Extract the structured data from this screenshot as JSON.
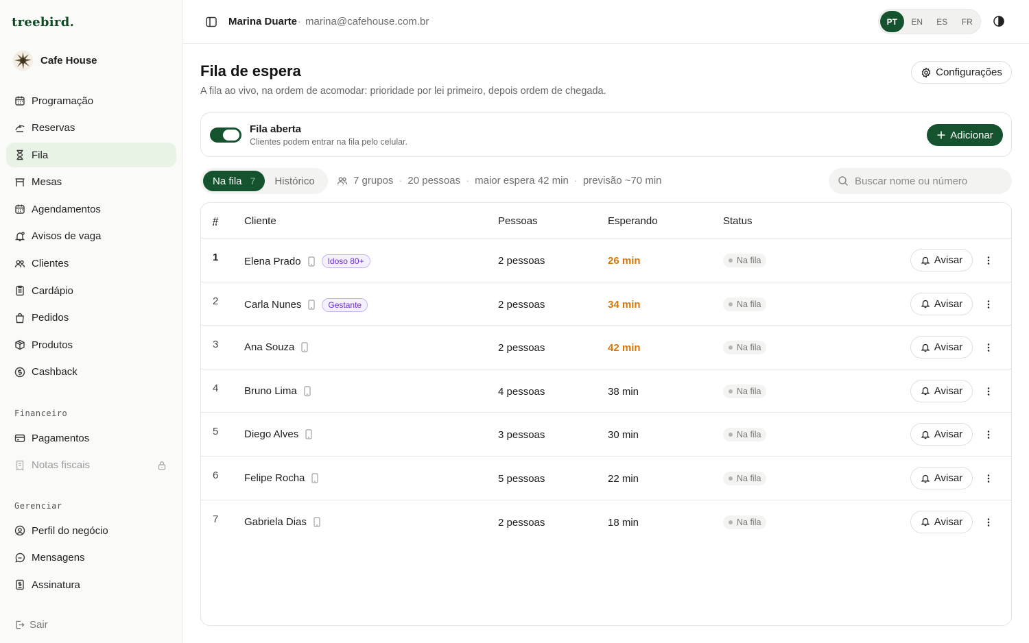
{
  "brand": {
    "logo_text": "treebird."
  },
  "business": {
    "name": "Cafe House",
    "avatar": "cafe-logo"
  },
  "sidebar": {
    "items": [
      {
        "label": "Programação",
        "icon": "calendar-icon"
      },
      {
        "label": "Reservas",
        "icon": "reservation-icon"
      },
      {
        "label": "Fila",
        "icon": "hourglass-icon",
        "active": true
      },
      {
        "label": "Mesas",
        "icon": "table-icon"
      },
      {
        "label": "Agendamentos",
        "icon": "calendar-icon"
      },
      {
        "label": "Avisos de vaga",
        "icon": "bell-icon"
      },
      {
        "label": "Clientes",
        "icon": "users-icon"
      },
      {
        "label": "Cardápio",
        "icon": "menu-book-icon"
      },
      {
        "label": "Pedidos",
        "icon": "bag-icon"
      },
      {
        "label": "Produtos",
        "icon": "box-icon"
      },
      {
        "label": "Cashback",
        "icon": "cashback-icon"
      }
    ],
    "financeiro_label": "Financeiro",
    "financeiro": [
      {
        "label": "Pagamentos",
        "icon": "card-icon"
      },
      {
        "label": "Notas fiscais",
        "icon": "receipt-icon",
        "locked": true
      }
    ],
    "gerenciar_label": "Gerenciar",
    "gerenciar": [
      {
        "label": "Perfil do negócio",
        "icon": "location-icon"
      },
      {
        "label": "Mensagens",
        "icon": "chat-icon"
      },
      {
        "label": "Assinatura",
        "icon": "invoice-icon"
      }
    ],
    "logout_label": "Sair"
  },
  "topbar": {
    "user_name": "Marina Duarte",
    "separator": "·",
    "user_email": "marina@cafehouse.com.br",
    "languages": [
      "PT",
      "EN",
      "ES",
      "FR"
    ],
    "active_language": "PT"
  },
  "page": {
    "title": "Fila de espera",
    "subtitle": "A fila ao vivo, na ordem de acomodar: prioridade por lei primeiro, depois ordem de chegada.",
    "settings_label": "Configurações"
  },
  "queue_status": {
    "title": "Fila aberta",
    "description": "Clientes podem entrar na fila pelo celular.",
    "open": true,
    "add_label": "Adicionar"
  },
  "tabs": [
    {
      "label": "Na fila",
      "count": "7",
      "active": true
    },
    {
      "label": "Histórico"
    }
  ],
  "stats": {
    "groups": "7 grupos",
    "people": "20 pessoas",
    "max_wait": "maior espera 42 min",
    "forecast": "previsão ~70 min"
  },
  "search": {
    "placeholder": "Buscar nome ou número",
    "value": ""
  },
  "table": {
    "headers": {
      "num": "#",
      "client": "Cliente",
      "people": "Pessoas",
      "waiting": "Esperando",
      "status": "Status"
    },
    "notify_label": "Avisar",
    "rows": [
      {
        "num": "1",
        "name": "Elena Prado",
        "tag": "Idoso 80+",
        "people": "2 pessoas",
        "waiting": "26 min",
        "late": true,
        "status": "Na fila"
      },
      {
        "num": "2",
        "name": "Carla Nunes",
        "tag": "Gestante",
        "people": "2 pessoas",
        "waiting": "34 min",
        "late": true,
        "status": "Na fila"
      },
      {
        "num": "3",
        "name": "Ana Souza",
        "tag": "",
        "people": "2 pessoas",
        "waiting": "42 min",
        "late": true,
        "status": "Na fila"
      },
      {
        "num": "4",
        "name": "Bruno Lima",
        "tag": "",
        "people": "4 pessoas",
        "waiting": "38 min",
        "late": false,
        "status": "Na fila"
      },
      {
        "num": "5",
        "name": "Diego Alves",
        "tag": "",
        "people": "3 pessoas",
        "waiting": "30 min",
        "late": false,
        "status": "Na fila"
      },
      {
        "num": "6",
        "name": "Felipe Rocha",
        "tag": "",
        "people": "5 pessoas",
        "waiting": "22 min",
        "late": false,
        "status": "Na fila"
      },
      {
        "num": "7",
        "name": "Gabriela Dias",
        "tag": "",
        "people": "2 pessoas",
        "waiting": "18 min",
        "late": false,
        "status": "Na fila"
      }
    ]
  },
  "colors": {
    "brand": "#14532d",
    "active_nav": "#e8f3e5",
    "late_wait": "#d97706",
    "priority_tag": "#6d28d9"
  }
}
